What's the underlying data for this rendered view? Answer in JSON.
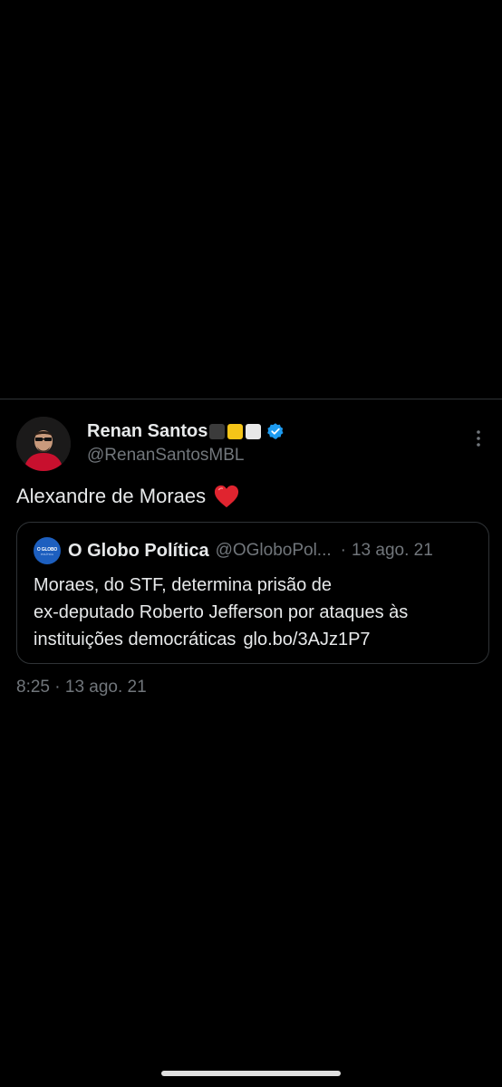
{
  "tweet": {
    "author_name": "Renan Santos",
    "author_emoji_colors": [
      "#3b3b3b",
      "#f5c518",
      "#e8e8e8"
    ],
    "handle": "@RenanSantosMBL",
    "text": "Alexandre de Moraes",
    "text_emoji": "red-heart-icon",
    "time": "8:25",
    "date_separator": "·",
    "date": "13 ago. 21"
  },
  "quote": {
    "logo_text": "O GLOBO",
    "logo_subtext": "POLÍTICA",
    "name": "O Globo Política",
    "handle": "@OGloboPol...",
    "separator": "·",
    "date": "13 ago. 21",
    "lines": [
      "Moraes, do STF, determina prisão de",
      "ex-deputado Roberto Jefferson por ataques às",
      "instituições democráticas"
    ],
    "link": "glo.bo/3AJz1P7"
  },
  "colors": {
    "background": "#000000",
    "text_primary": "#e7e9ea",
    "text_secondary": "#71767b",
    "border": "#2f3336",
    "verified_blue": "#1d9bf0",
    "heart_red": "#e0242f",
    "quote_logo_blue": "#1d5fbf"
  }
}
